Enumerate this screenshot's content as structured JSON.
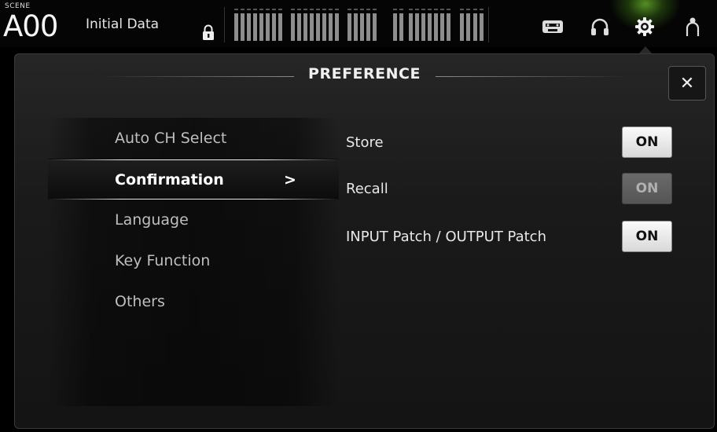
{
  "header": {
    "scene_label": "SCENE",
    "scene_number": "A00",
    "scene_name": "Initial Data",
    "icons": [
      "lock-icon",
      "recorder-icon",
      "headphones-icon",
      "gear-icon",
      "user-icon"
    ],
    "accent_glow": "#8cff3c"
  },
  "dialog": {
    "title": "PREFERENCE",
    "close_label": "✕"
  },
  "menu": {
    "items": [
      {
        "label": "Auto CH Select"
      },
      {
        "label": "Confirmation",
        "selected": true
      },
      {
        "label": "Language"
      },
      {
        "label": "Key Function"
      },
      {
        "label": "Others"
      }
    ],
    "chevron": ">"
  },
  "options": [
    {
      "label": "Store",
      "button": "ON",
      "state": "on"
    },
    {
      "label": "Recall",
      "button": "ON",
      "state": "off"
    },
    {
      "label": "INPUT Patch / OUTPUT Patch",
      "button": "ON",
      "state": "on"
    }
  ]
}
